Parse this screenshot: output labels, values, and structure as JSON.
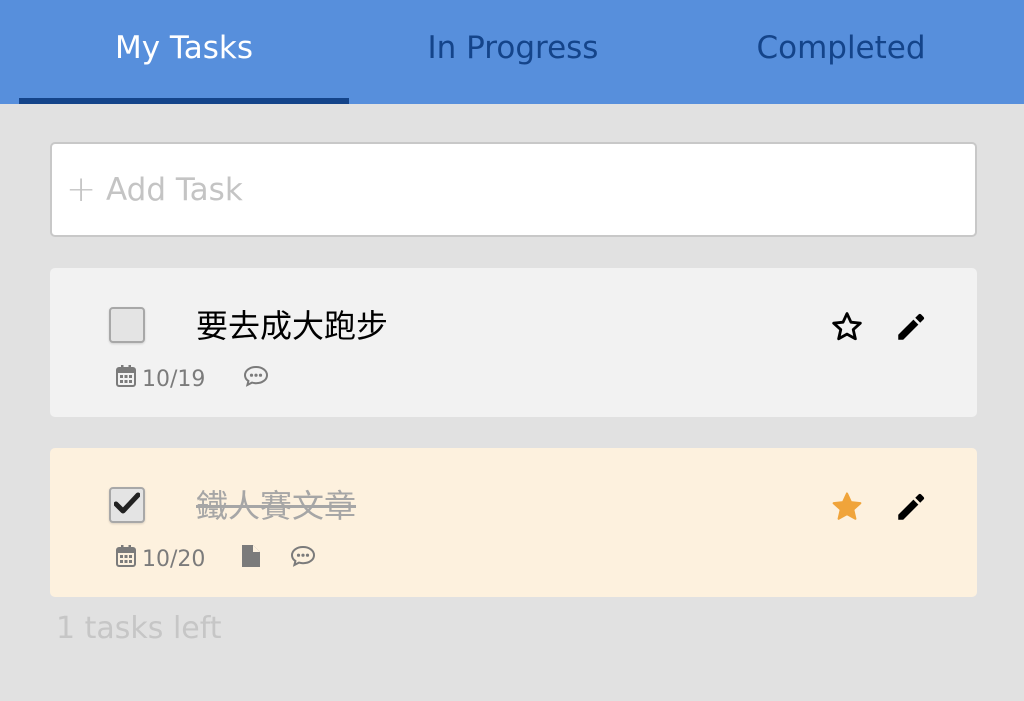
{
  "tabs": [
    {
      "label": "My Tasks",
      "active": true
    },
    {
      "label": "In Progress",
      "active": false
    },
    {
      "label": "Completed",
      "active": false
    }
  ],
  "add_task": {
    "plus": "+",
    "placeholder": "Add Task"
  },
  "tasks": [
    {
      "title": "要去成大跑步",
      "date": "10/19",
      "completed": false,
      "starred": false,
      "has_file": false,
      "has_comment": true
    },
    {
      "title": "鐵人賽文章",
      "date": "10/20",
      "completed": true,
      "starred": true,
      "has_file": true,
      "has_comment": true
    }
  ],
  "footer": {
    "count_text": "1 tasks left"
  },
  "colors": {
    "header_bg": "#578fdc",
    "active_tab_text": "#ffffff",
    "inactive_tab_text": "#14448a",
    "starred_color": "#f0a43a",
    "completed_card_bg": "#fdf1de"
  },
  "icons": {
    "add": "plus-icon",
    "date": "calendar-icon",
    "comment": "comment-icon",
    "file": "file-icon",
    "star_empty": "star-outline-icon",
    "star_filled": "star-filled-icon",
    "edit": "pencil-icon",
    "check": "checkmark-icon"
  }
}
